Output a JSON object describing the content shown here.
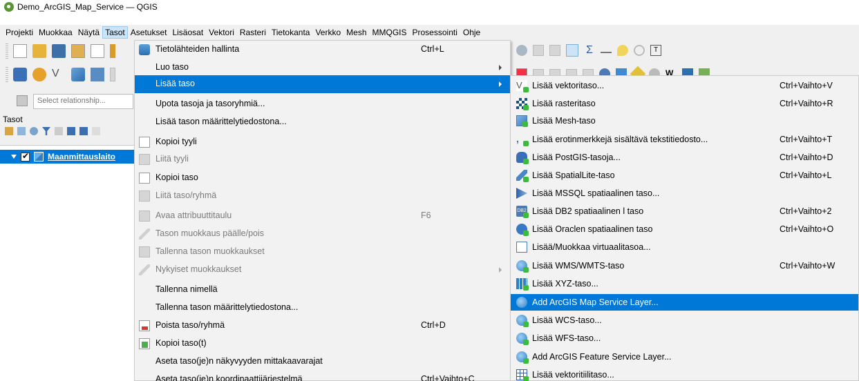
{
  "window": {
    "title": "Demo_ArcGIS_Map_Service — QGIS"
  },
  "menubar": [
    {
      "label": "Projekti",
      "active": false
    },
    {
      "label": "Muokkaa",
      "active": false
    },
    {
      "label": "Näytä",
      "active": false
    },
    {
      "label": "Tasot",
      "active": true
    },
    {
      "label": "Asetukset",
      "active": false
    },
    {
      "label": "Lisäosat",
      "active": false
    },
    {
      "label": "Vektori",
      "active": false
    },
    {
      "label": "Rasteri",
      "active": false
    },
    {
      "label": "Tietokanta",
      "active": false
    },
    {
      "label": "Verkko",
      "active": false
    },
    {
      "label": "Mesh",
      "active": false
    },
    {
      "label": "MMQGIS",
      "active": false
    },
    {
      "label": "Prosessointi",
      "active": false
    },
    {
      "label": "Ohje",
      "active": false
    }
  ],
  "left_panel": {
    "relationship_placeholder": "Select relationship...",
    "layers_title": "Tasot",
    "layer_name": "Maanmittauslaito"
  },
  "tasot_menu": [
    {
      "label": "Tietolähteiden hallinta",
      "shortcut": "Ctrl+L",
      "icon": "data-source-manager-icon",
      "disabled": false,
      "submenu": false,
      "highlighted": false
    },
    {
      "label": "Luo taso",
      "shortcut": "",
      "icon": "",
      "disabled": false,
      "submenu": true,
      "highlighted": false
    },
    {
      "label": "Lisää taso",
      "shortcut": "",
      "icon": "",
      "disabled": false,
      "submenu": true,
      "highlighted": true
    },
    {
      "label": "Upota tasoja ja tasoryhmiä...",
      "shortcut": "",
      "icon": "",
      "disabled": false,
      "submenu": false,
      "highlighted": false
    },
    {
      "label": "Lisää tason määrittelytiedostona...",
      "shortcut": "",
      "icon": "",
      "disabled": false,
      "submenu": false,
      "highlighted": false
    },
    {
      "label": "Kopioi tyyli",
      "shortcut": "",
      "icon": "copy-style-icon",
      "disabled": false,
      "submenu": false,
      "highlighted": false
    },
    {
      "label": "Liitä tyyli",
      "shortcut": "",
      "icon": "paste-style-icon",
      "disabled": true,
      "submenu": false,
      "highlighted": false
    },
    {
      "label": "Kopioi taso",
      "shortcut": "",
      "icon": "copy-layer-icon",
      "disabled": false,
      "submenu": false,
      "highlighted": false
    },
    {
      "label": "Liitä taso/ryhmä",
      "shortcut": "",
      "icon": "paste-layer-icon",
      "disabled": true,
      "submenu": false,
      "highlighted": false
    },
    {
      "label": "Avaa attribuuttitaulu",
      "shortcut": "F6",
      "icon": "attribute-table-icon",
      "disabled": true,
      "submenu": false,
      "highlighted": false
    },
    {
      "label": "Tason muokkaus päälle/pois",
      "shortcut": "",
      "icon": "toggle-editing-icon",
      "disabled": true,
      "submenu": false,
      "highlighted": false
    },
    {
      "label": "Tallenna tason muokkaukset",
      "shortcut": "",
      "icon": "save-edits-icon",
      "disabled": true,
      "submenu": false,
      "highlighted": false
    },
    {
      "label": "Nykyiset muokkaukset",
      "shortcut": "",
      "icon": "current-edits-icon",
      "disabled": true,
      "submenu": true,
      "highlighted": false
    },
    {
      "label": "Tallenna nimellä",
      "shortcut": "",
      "icon": "",
      "disabled": false,
      "submenu": false,
      "highlighted": false
    },
    {
      "label": "Tallenna tason määrittelytiedostona...",
      "shortcut": "",
      "icon": "",
      "disabled": false,
      "submenu": false,
      "highlighted": false
    },
    {
      "label": "Poista taso/ryhmä",
      "shortcut": "Ctrl+D",
      "icon": "remove-layer-icon",
      "disabled": false,
      "submenu": false,
      "highlighted": false
    },
    {
      "label": "Kopioi taso(t)",
      "shortcut": "",
      "icon": "duplicate-layer-icon",
      "disabled": false,
      "submenu": false,
      "highlighted": false
    },
    {
      "label": "Aseta taso(je)n näkyvyyden mittakaavarajat",
      "shortcut": "",
      "icon": "",
      "disabled": false,
      "submenu": false,
      "highlighted": false
    },
    {
      "label": "Aseta taso(je)n koordinaattijärjestelmä",
      "shortcut": "Ctrl+Vaihto+C",
      "icon": "",
      "disabled": false,
      "submenu": false,
      "highlighted": false
    }
  ],
  "add_layer_menu": [
    {
      "label": "Lisää vektoritaso...",
      "shortcut": "Ctrl+Vaihto+V",
      "icon": "add-vector-layer-icon",
      "highlighted": false
    },
    {
      "label": "Lisää rasteritaso",
      "shortcut": "Ctrl+Vaihto+R",
      "icon": "add-raster-layer-icon",
      "highlighted": false
    },
    {
      "label": "Lisää Mesh-taso",
      "shortcut": "",
      "icon": "add-mesh-layer-icon",
      "highlighted": false
    },
    {
      "label": "Lisää erotinmerkkejä sisältävä tekstitiedosto...",
      "shortcut": "Ctrl+Vaihto+T",
      "icon": "add-delimited-text-icon",
      "highlighted": false
    },
    {
      "label": "Lisää PostGIS-tasoja...",
      "shortcut": "Ctrl+Vaihto+D",
      "icon": "add-postgis-icon",
      "highlighted": false
    },
    {
      "label": "Lisää SpatialLite-taso",
      "shortcut": "Ctrl+Vaihto+L",
      "icon": "add-spatialite-icon",
      "highlighted": false
    },
    {
      "label": "Lisää MSSQL spatiaalinen taso...",
      "shortcut": "",
      "icon": "add-mssql-icon",
      "highlighted": false
    },
    {
      "label": "Lisää DB2 spatiaalinen l taso",
      "shortcut": "Ctrl+Vaihto+2",
      "icon": "add-db2-icon",
      "highlighted": false
    },
    {
      "label": "Lisää Oraclen spatiaalinen taso",
      "shortcut": "Ctrl+Vaihto+O",
      "icon": "add-oracle-icon",
      "highlighted": false
    },
    {
      "label": "Lisää/Muokkaa virtuaalitasoa...",
      "shortcut": "",
      "icon": "add-virtual-layer-icon",
      "highlighted": false
    },
    {
      "label": "Lisää WMS/WMTS-taso",
      "shortcut": "Ctrl+Vaihto+W",
      "icon": "add-wms-icon",
      "highlighted": false
    },
    {
      "label": "Lisää XYZ-taso...",
      "shortcut": "",
      "icon": "add-xyz-icon",
      "highlighted": false
    },
    {
      "label": "Add ArcGIS Map Service Layer...",
      "shortcut": "",
      "icon": "add-arcgis-map-service-icon",
      "highlighted": true
    },
    {
      "label": "Lisää WCS-taso...",
      "shortcut": "",
      "icon": "add-wcs-icon",
      "highlighted": false
    },
    {
      "label": "Lisää WFS-taso...",
      "shortcut": "",
      "icon": "add-wfs-icon",
      "highlighted": false
    },
    {
      "label": "Add ArcGIS Feature Service Layer...",
      "shortcut": "",
      "icon": "add-arcgis-feature-service-icon",
      "highlighted": false
    },
    {
      "label": "Lisää vektoritiilitaso...",
      "shortcut": "",
      "icon": "add-vector-tile-icon",
      "highlighted": false
    }
  ],
  "colors": {
    "highlight": "#0078d7",
    "menu_bg": "#f2f2f2",
    "disabled_text": "#7a7a7a"
  }
}
